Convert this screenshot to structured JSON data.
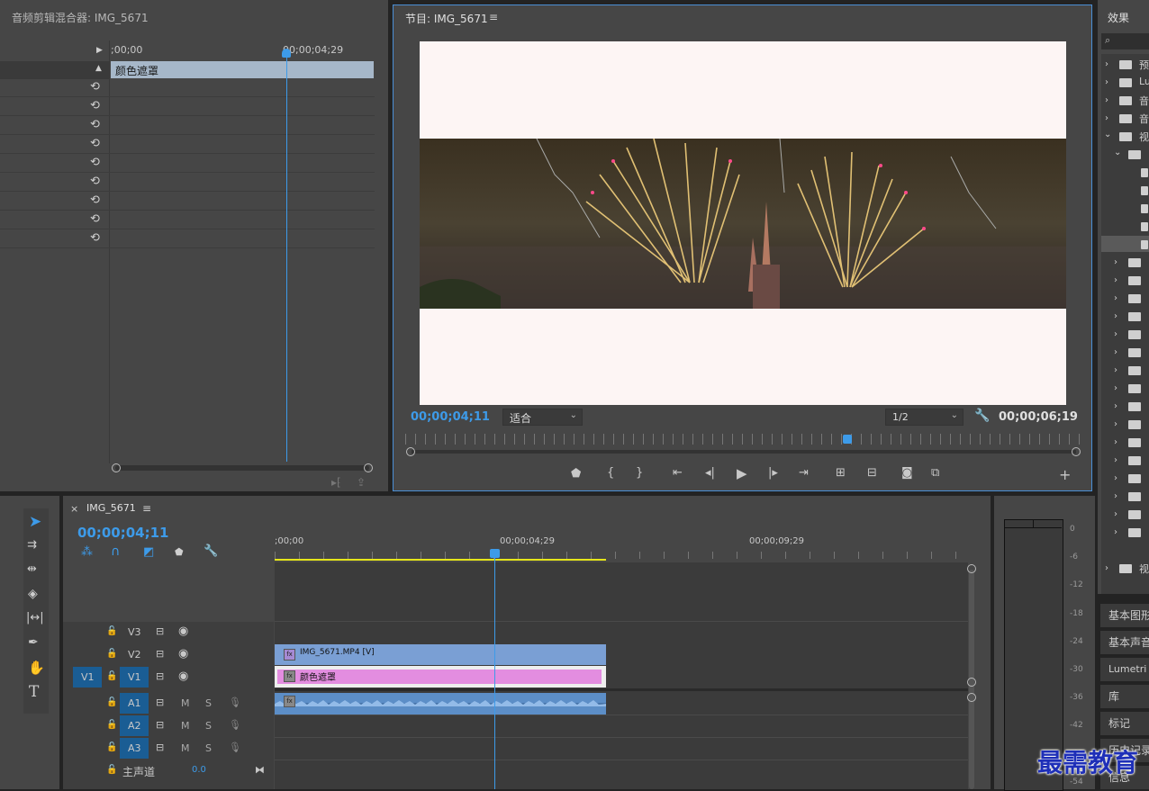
{
  "audio_mixer": {
    "title": "音频剪辑混合器: IMG_5671",
    "timecode_start": ";00;00",
    "timecode_mark": "00;00;04;29",
    "clip_label": "颜色遮罩"
  },
  "program": {
    "title": "节目: IMG_5671",
    "menu_icon": "hamburger-icon",
    "current_time": "00;00;04;11",
    "fit_label": "适合",
    "resolution": "1/2",
    "duration": "00;00;06;19",
    "playhead_fraction": 0.66
  },
  "effects": {
    "title": "效果",
    "items": [
      {
        "label": "预"
      },
      {
        "label": "Lu"
      },
      {
        "label": "音"
      },
      {
        "label": "音"
      },
      {
        "label": "视"
      },
      {
        "label": "视"
      }
    ]
  },
  "sequence": {
    "close_glyph": "×",
    "title": "IMG_5671",
    "current_time": "00;00;04;11",
    "ruler": [
      ";00;00",
      "00;00;04;29",
      "00;00;09;29"
    ],
    "video_tracks": [
      {
        "name": "V3",
        "source": ""
      },
      {
        "name": "V2",
        "source": ""
      },
      {
        "name": "V1",
        "source": "V1"
      }
    ],
    "audio_tracks": [
      {
        "name": "A1",
        "m": "M",
        "s": "S"
      },
      {
        "name": "A2",
        "m": "M",
        "s": "S"
      },
      {
        "name": "A3",
        "m": "M",
        "s": "S"
      }
    ],
    "master_label": "主声道",
    "master_value": "0.0",
    "clips": {
      "v2_clip": "IMG_5671.MP4 [V]",
      "v1_clip": "颜色遮罩"
    }
  },
  "meter": {
    "scale": [
      "0",
      "-6",
      "-12",
      "-18",
      "-24",
      "-30",
      "-36",
      "-42",
      "-48",
      "-54"
    ]
  },
  "right_panels": [
    "基本图形",
    "基本声音",
    "Lumetri 范围",
    "库",
    "标记",
    "历史记录",
    "信息"
  ],
  "watermark": "最需教育",
  "colors": {
    "accent": "#3d9be9",
    "v2_clip": "#7a9fd4",
    "v1_clip": "#e38de0",
    "audio_clip": "#5c8ec7",
    "work_area": "#e5e51a"
  }
}
